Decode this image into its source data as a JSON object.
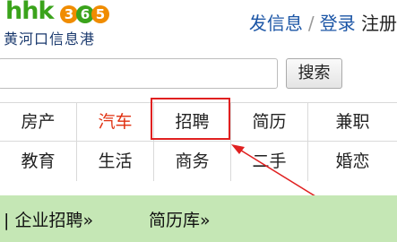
{
  "logo": {
    "hhk": "hhk",
    "nums": [
      "3",
      "6",
      "5"
    ],
    "subtitle": "黄河口信息港"
  },
  "topnav": {
    "post": "发信息",
    "sep": "/",
    "login": "登录",
    "register": "注册"
  },
  "search": {
    "value": "",
    "button": "搜索"
  },
  "categories": {
    "row1": [
      "房产",
      "汽车",
      "招聘",
      "简历",
      "兼职"
    ],
    "row2": [
      "教育",
      "生活",
      "商务",
      "二手",
      "婚恋"
    ]
  },
  "colors": {
    "accent_link": "#1c56a6",
    "highlight_red": "#e02020",
    "car_red": "#e03010",
    "green_bar": "#c5e7b5"
  },
  "green_bar": {
    "item1": "| 企业招聘»",
    "item2": "简历库»"
  }
}
